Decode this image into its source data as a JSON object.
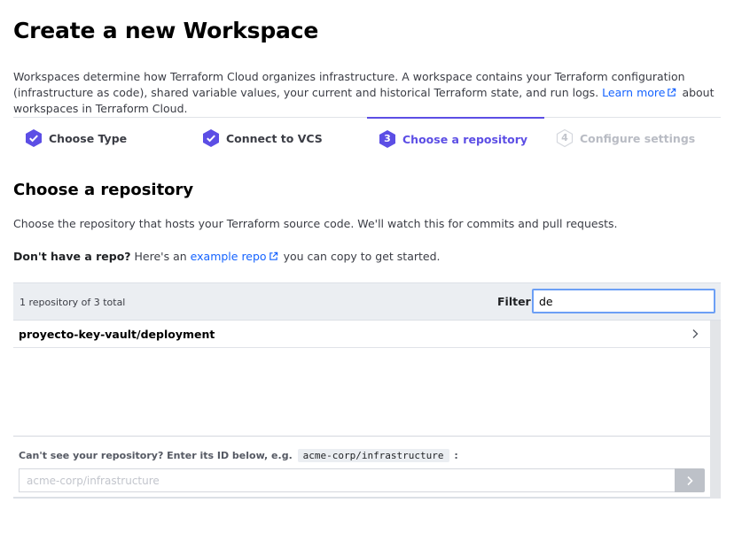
{
  "page": {
    "title": "Create a new Workspace",
    "intro_text": "Workspaces determine how Terraform Cloud organizes infrastructure. A workspace contains your Terraform configuration (infrastructure as code), shared variable values, your current and historical Terraform state, and run logs.",
    "learn_more_label": "Learn more",
    "intro_suffix": "about workspaces in Terraform Cloud."
  },
  "steps": [
    {
      "label": "Choose Type",
      "state": "done",
      "icon": "check-badge-icon"
    },
    {
      "label": "Connect to VCS",
      "state": "done",
      "icon": "check-badge-icon"
    },
    {
      "label": "Choose a repository",
      "state": "active",
      "number": "3"
    },
    {
      "label": "Configure settings",
      "state": "pending",
      "number": "4"
    }
  ],
  "section": {
    "title": "Choose a repository",
    "description": "Choose the repository that hosts your Terraform source code. We'll watch this for commits and pull requests.",
    "no_repo_bold": "Don't have a repo?",
    "no_repo_prefix": "Here's an",
    "example_repo_label": "example repo",
    "no_repo_suffix": "you can copy to get started."
  },
  "repo_list": {
    "count_text": "1 repository of 3 total",
    "filter_label": "Filter",
    "filter_value": "de",
    "items": [
      {
        "name": "proyecto-key-vault/deployment"
      }
    ]
  },
  "manual_entry": {
    "label_prefix": "Can't see your repository? Enter its ID below, e.g.",
    "example_id": "acme-corp/infrastructure",
    "label_suffix": ":",
    "placeholder": "acme-corp/infrastructure"
  },
  "colors": {
    "accent": "#5c4ee5",
    "link": "#1563ff",
    "pending": "#b9bcc4"
  }
}
